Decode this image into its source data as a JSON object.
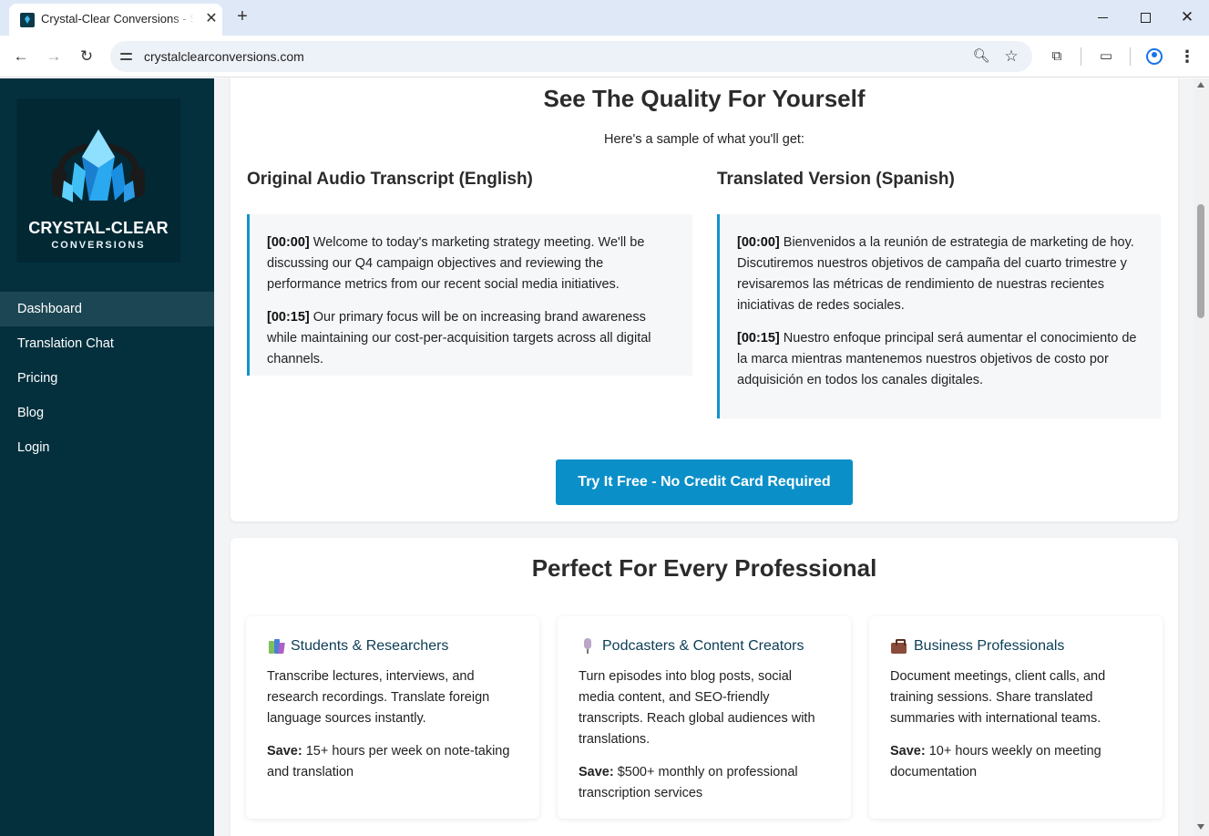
{
  "browser": {
    "tab_title": "Crystal-Clear Conversions - Stop",
    "url": "crystalclearconversions.com",
    "icons": [
      "favicon",
      "close-icon",
      "plus-icon",
      "back-arrow-icon",
      "forward-arrow-icon",
      "reload-icon",
      "site-info-icon",
      "zoom-icon",
      "star-icon",
      "extensions-icon",
      "side-panel-icon",
      "profile-icon",
      "menu-icon"
    ]
  },
  "sidebar": {
    "logo_title": "CRYSTAL-CLEAR",
    "logo_subtitle": "CONVERSIONS",
    "items": [
      {
        "label": "Dashboard",
        "active": true
      },
      {
        "label": "Translation Chat"
      },
      {
        "label": "Pricing"
      },
      {
        "label": "Blog"
      },
      {
        "label": "Login"
      }
    ]
  },
  "quality": {
    "heading": "See The Quality For Yourself",
    "intro": "Here's a sample of what you'll get:",
    "original": {
      "title": "Original Audio Transcript (English)",
      "entries": [
        {
          "time": "[00:00]",
          "text": "Welcome to today's marketing strategy meeting. We'll be discussing our Q4 campaign objectives and reviewing the performance metrics from our recent social media initiatives."
        },
        {
          "time": "[00:15]",
          "text": "Our primary focus will be on increasing brand awareness while maintaining our cost-per-acquisition targets across all digital channels."
        }
      ]
    },
    "translated": {
      "title": "Translated Version (Spanish)",
      "entries": [
        {
          "time": "[00:00]",
          "text": "Bienvenidos a la reunión de estrategia de marketing de hoy. Discutiremos nuestros objetivos de campaña del cuarto trimestre y revisaremos las métricas de rendimiento de nuestras recientes iniciativas de redes sociales."
        },
        {
          "time": "[00:15]",
          "text": "Nuestro enfoque principal será aumentar el conocimiento de la marca mientras mantenemos nuestros objetivos de costo por adquisición en todos los canales digitales."
        }
      ]
    },
    "cta_label": "Try It Free - No Credit Card Required"
  },
  "professionals": {
    "heading": "Perfect For Every Professional",
    "save_label": "Save:",
    "cards": [
      {
        "icon": "books-icon",
        "title": "Students & Researchers",
        "description": "Transcribe lectures, interviews, and research recordings. Translate foreign language sources instantly.",
        "save": "15+ hours per week on note-taking and translation"
      },
      {
        "icon": "microphone-icon",
        "title": "Podcasters & Content Creators",
        "description": "Turn episodes into blog posts, social media content, and SEO-friendly transcripts. Reach global audiences with translations.",
        "save": "$500+ monthly on professional transcription services"
      },
      {
        "icon": "briefcase-icon",
        "title": "Business Professionals",
        "description": "Document meetings, client calls, and training sessions. Share translated summaries with international teams.",
        "save": "10+ hours weekly on meeting documentation"
      }
    ]
  },
  "colors": {
    "sidebar_bg": "#04303e",
    "accent": "#0b8fc9",
    "sample_border": "#1192cc"
  }
}
